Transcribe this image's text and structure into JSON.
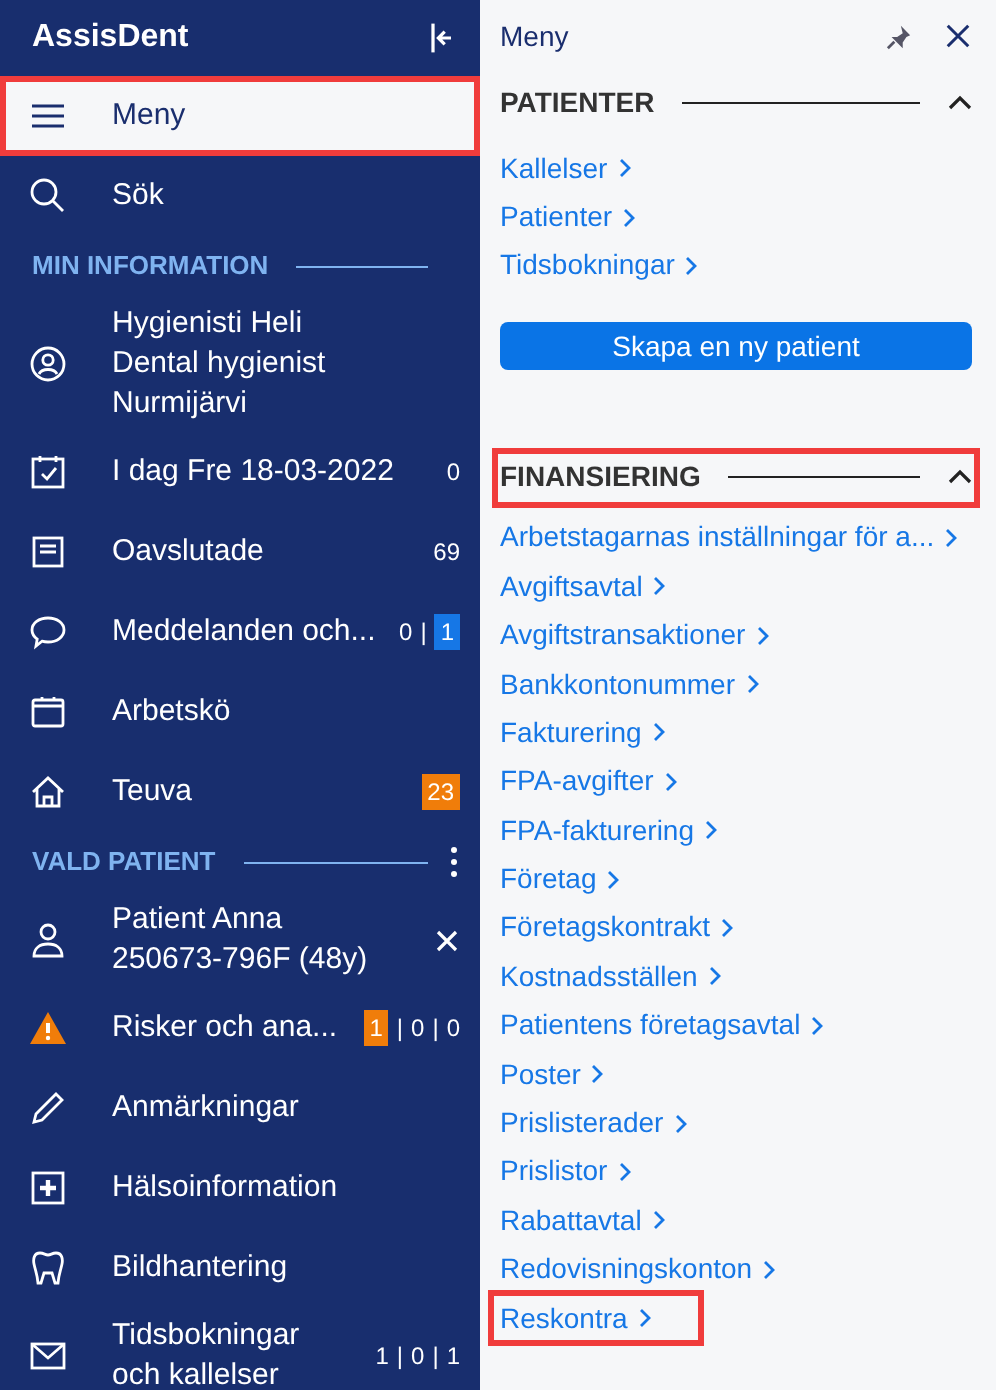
{
  "sidebar": {
    "brand": "AssisDent",
    "items": [
      {
        "kind": "item",
        "lines": [
          "Meny"
        ],
        "highlighted": true
      },
      {
        "kind": "item",
        "lines": [
          "Sök"
        ],
        "highlighted": false
      },
      {
        "kind": "heading",
        "label": "MIN INFORMATION",
        "menu": false
      },
      {
        "kind": "item",
        "lines": [
          "Hygienisti Heli",
          "Dental hygienist",
          "Nurmijärvi"
        ],
        "highlighted": false
      },
      {
        "kind": "item",
        "lines": [
          "I dag Fre 18-03-2022"
        ],
        "highlighted": false,
        "counts": [
          {
            "text": "0",
            "kind": "plain"
          }
        ]
      },
      {
        "kind": "item",
        "lines": [
          "Oavslutade"
        ],
        "highlighted": false,
        "counts": [
          {
            "text": "69",
            "kind": "plain"
          }
        ]
      },
      {
        "kind": "item",
        "lines": [
          "Meddelanden och..."
        ],
        "highlighted": false,
        "counts": [
          {
            "text": "0",
            "kind": "plain"
          },
          {
            "text": "|",
            "kind": "separator"
          },
          {
            "text": "1",
            "kind": "blue"
          }
        ]
      },
      {
        "kind": "item",
        "lines": [
          "Arbetskö"
        ],
        "highlighted": false
      },
      {
        "kind": "item",
        "lines": [
          "Teuva"
        ],
        "highlighted": false,
        "counts": [
          {
            "text": "23",
            "kind": "orange"
          }
        ]
      },
      {
        "kind": "heading",
        "label": "VALD PATIENT",
        "menu": true
      },
      {
        "kind": "item",
        "lines": [
          "Patient Anna",
          "250673-796F (48y)"
        ],
        "highlighted": false,
        "closable": true
      },
      {
        "kind": "item",
        "lines": [
          "Risker och ana..."
        ],
        "highlighted": false,
        "counts": [
          {
            "text": "1",
            "kind": "orange"
          },
          {
            "text": "|",
            "kind": "separator"
          },
          {
            "text": "0",
            "kind": "plain"
          },
          {
            "text": "|",
            "kind": "separator"
          },
          {
            "text": "0",
            "kind": "plain"
          }
        ]
      },
      {
        "kind": "item",
        "lines": [
          "Anmärkningar"
        ],
        "highlighted": false
      },
      {
        "kind": "item",
        "lines": [
          "Hälsoinformation"
        ],
        "highlighted": false
      },
      {
        "kind": "item",
        "lines": [
          "Bildhantering"
        ],
        "highlighted": false
      },
      {
        "kind": "item",
        "lines": [
          "Tidsbokningar",
          "och kallelser"
        ],
        "highlighted": false,
        "counts": [
          {
            "text": "1",
            "kind": "plain"
          },
          {
            "text": "|",
            "kind": "separator"
          },
          {
            "text": "0",
            "kind": "plain"
          },
          {
            "text": "|",
            "kind": "separator"
          },
          {
            "text": "1",
            "kind": "plain"
          }
        ]
      }
    ]
  },
  "panel": {
    "title": "Meny",
    "sections": [
      {
        "title": "PATIENTER",
        "expanded": true,
        "highlighted": false,
        "links": [
          {
            "label": "Kallelser",
            "highlighted": false
          },
          {
            "label": "Patienter",
            "highlighted": false
          },
          {
            "label": "Tidsbokningar",
            "highlighted": false
          }
        ],
        "button": "Skapa en ny patient"
      },
      {
        "title": "FINANSIERING",
        "expanded": true,
        "highlighted": true,
        "links": [
          {
            "label": "Arbetstagarnas inställningar för a...",
            "highlighted": false
          },
          {
            "label": "Avgiftsavtal",
            "highlighted": false
          },
          {
            "label": "Avgiftstransaktioner",
            "highlighted": false
          },
          {
            "label": "Bankkontonummer",
            "highlighted": false
          },
          {
            "label": "Fakturering",
            "highlighted": false
          },
          {
            "label": "FPA-avgifter",
            "highlighted": false
          },
          {
            "label": "FPA-fakturering",
            "highlighted": false
          },
          {
            "label": "Företag",
            "highlighted": false
          },
          {
            "label": "Företagskontrakt",
            "highlighted": false
          },
          {
            "label": "Kostnadsställen",
            "highlighted": false
          },
          {
            "label": "Patientens företagsavtal",
            "highlighted": false
          },
          {
            "label": "Poster",
            "highlighted": false
          },
          {
            "label": "Prislisterader",
            "highlighted": false
          },
          {
            "label": "Prislistor",
            "highlighted": false
          },
          {
            "label": "Rabattavtal",
            "highlighted": false
          },
          {
            "label": "Redovisningskonton",
            "highlighted": false
          },
          {
            "label": "Reskontra",
            "highlighted": true
          }
        ]
      }
    ]
  }
}
